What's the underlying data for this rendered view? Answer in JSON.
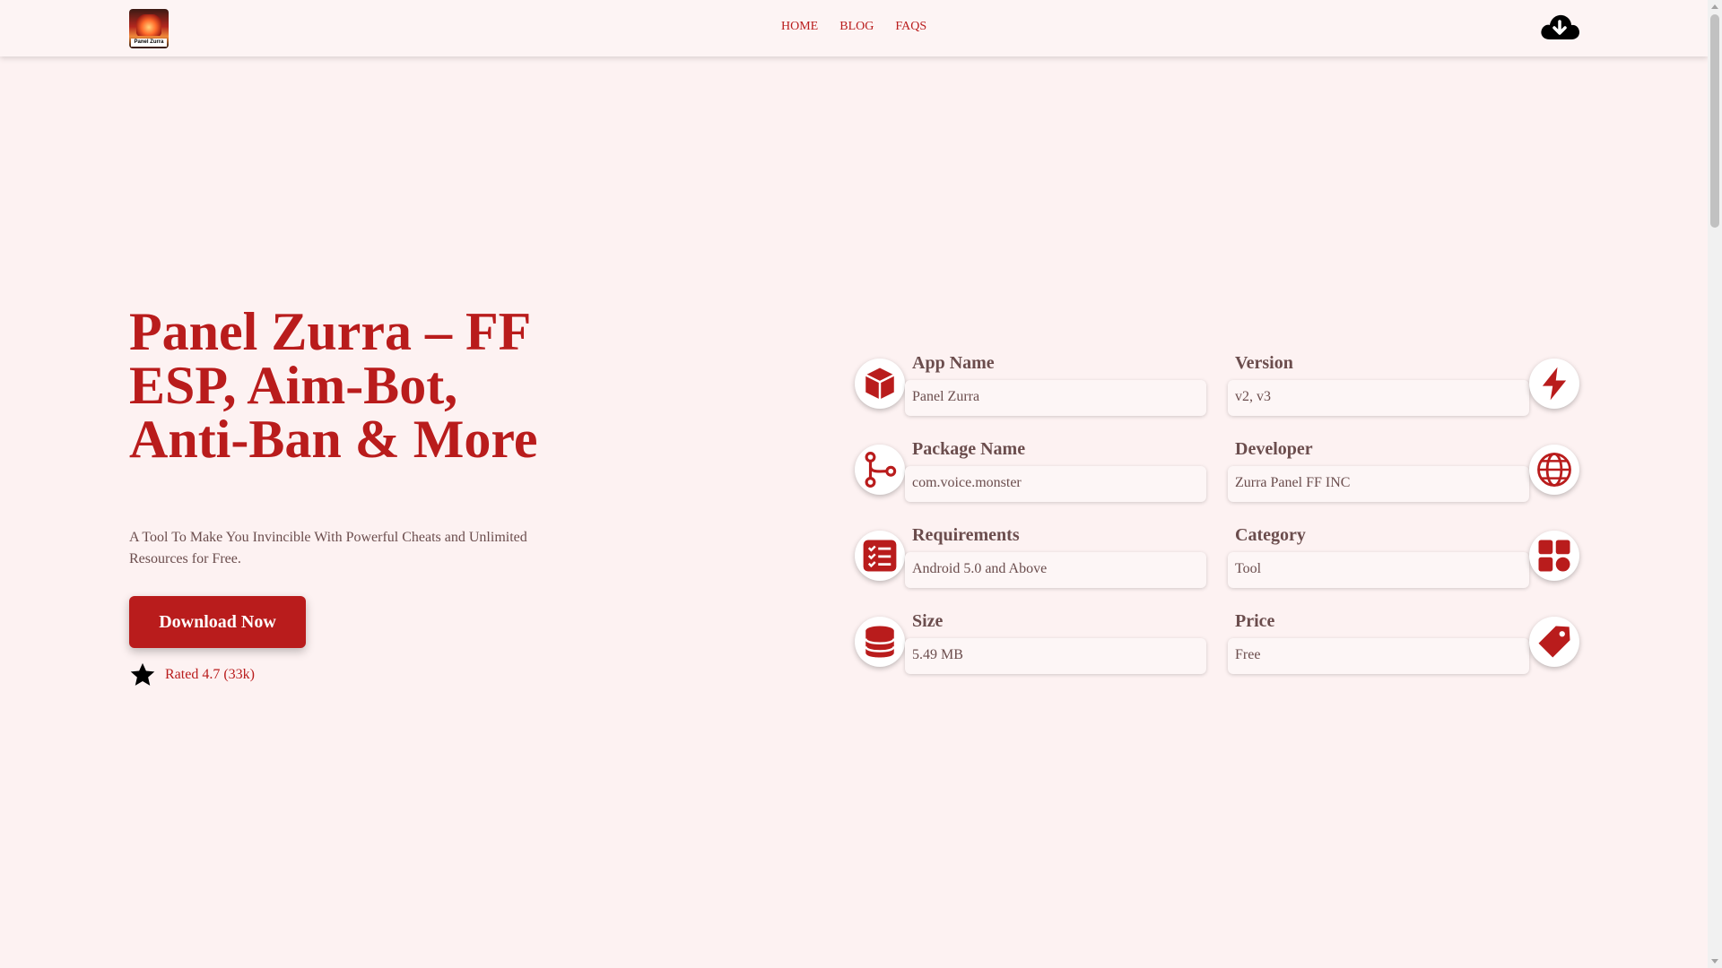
{
  "header": {
    "logo_text": "Panel Zurra",
    "nav": [
      "HOME",
      "BLOG",
      "FAQS"
    ],
    "download_icon": "cloud-download-icon"
  },
  "hero": {
    "title": "Panel Zurra – FF ESP, Aim-Bot, Anti-Ban & More",
    "subtitle": "A Tool To Make You Invincible With Powerful Cheats and Unlimited Resources for Free.",
    "download_label": "Download Now",
    "rating_text": "Rated 4.7 (33k)"
  },
  "info": [
    {
      "label": "App Name",
      "value": "Panel Zurra",
      "icon": "box-icon"
    },
    {
      "label": "Version",
      "value": "v2, v3",
      "icon": "lightning-icon"
    },
    {
      "label": "Package Name",
      "value": "com.voice.monster",
      "icon": "branch-icon"
    },
    {
      "label": "Developer",
      "value": "Zurra Panel FF INC",
      "icon": "globe-icon"
    },
    {
      "label": "Requirements",
      "value": "Android 5.0 and Above",
      "icon": "checklist-icon"
    },
    {
      "label": "Category",
      "value": "Tool",
      "icon": "grid-icon"
    },
    {
      "label": "Size",
      "value": "5.49 MB",
      "icon": "database-icon"
    },
    {
      "label": "Price",
      "value": "Free",
      "icon": "tag-icon"
    }
  ],
  "colors": {
    "accent": "#b91c1c",
    "background": "#fdf2f2",
    "text_muted": "#6b4d4d"
  }
}
